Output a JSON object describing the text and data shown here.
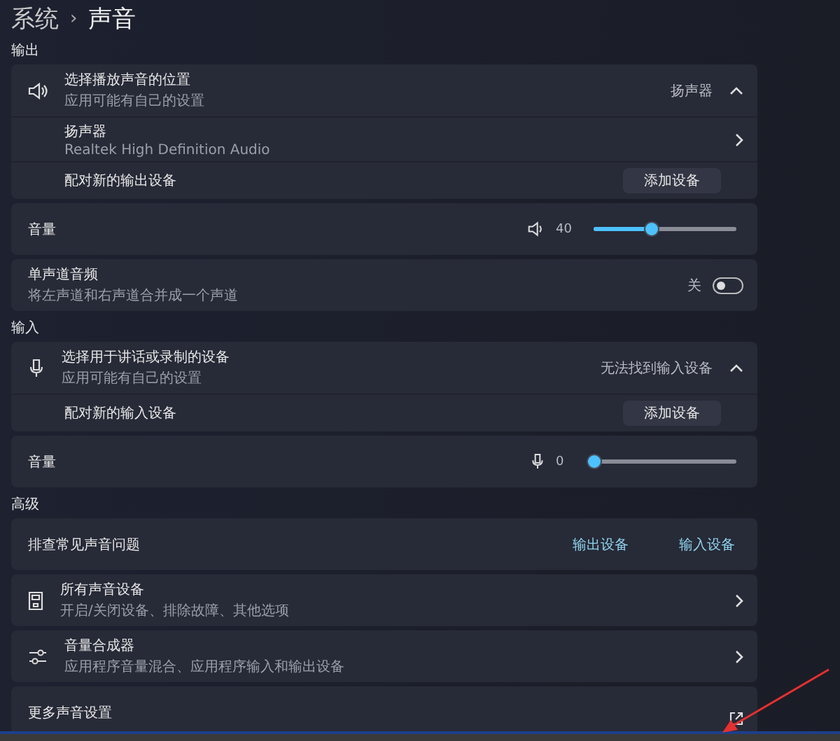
{
  "breadcrumb": {
    "parent": "系统",
    "separator": "›",
    "current": "声音"
  },
  "sections": [
    {
      "title": "输出",
      "cards": [
        {
          "rows": [
            {
              "kind": "output-picker",
              "title": "选择播放声音的位置",
              "subtitle": "应用可能有自己的设置",
              "value": "扬声器",
              "expanded": true
            },
            {
              "kind": "device",
              "title": "扬声器",
              "subtitle": "Realtek High Definition Audio"
            },
            {
              "kind": "pair",
              "title": "配对新的输出设备",
              "button": "添加设备"
            }
          ]
        },
        {
          "rows": [
            {
              "kind": "volume",
              "title": "音量",
              "reading": "40",
              "level": 0.4
            }
          ]
        },
        {
          "rows": [
            {
              "kind": "toggle",
              "title": "单声道音频",
              "subtitle": "将左声道和右声道合并成一个声道",
              "state_label": "关",
              "on": false
            }
          ]
        }
      ]
    },
    {
      "title": "输入",
      "cards": [
        {
          "rows": [
            {
              "kind": "input-picker",
              "title": "选择用于讲话或录制的设备",
              "subtitle": "应用可能有自己的设置",
              "value": "无法找到输入设备",
              "expanded": true
            },
            {
              "kind": "pair",
              "title": "配对新的输入设备",
              "button": "添加设备"
            }
          ]
        },
        {
          "rows": [
            {
              "kind": "mic-volume",
              "title": "音量",
              "reading": "0",
              "level": 0
            }
          ]
        }
      ]
    },
    {
      "title": "高级",
      "cards": [
        {
          "rows": [
            {
              "kind": "troubleshoot",
              "title": "排查常见声音问题",
              "links": [
                "输出设备",
                "输入设备"
              ]
            }
          ]
        },
        {
          "rows": [
            {
              "kind": "all-devices",
              "title": "所有声音设备",
              "subtitle": "开启/关闭设备、排除故障、其他选项"
            }
          ]
        },
        {
          "rows": [
            {
              "kind": "mixer",
              "title": "音量合成器",
              "subtitle": "应用程序音量混合、应用程序输入和输出设备"
            }
          ]
        },
        {
          "rows": [
            {
              "kind": "external",
              "title": "更多声音设置"
            }
          ]
        }
      ]
    }
  ]
}
